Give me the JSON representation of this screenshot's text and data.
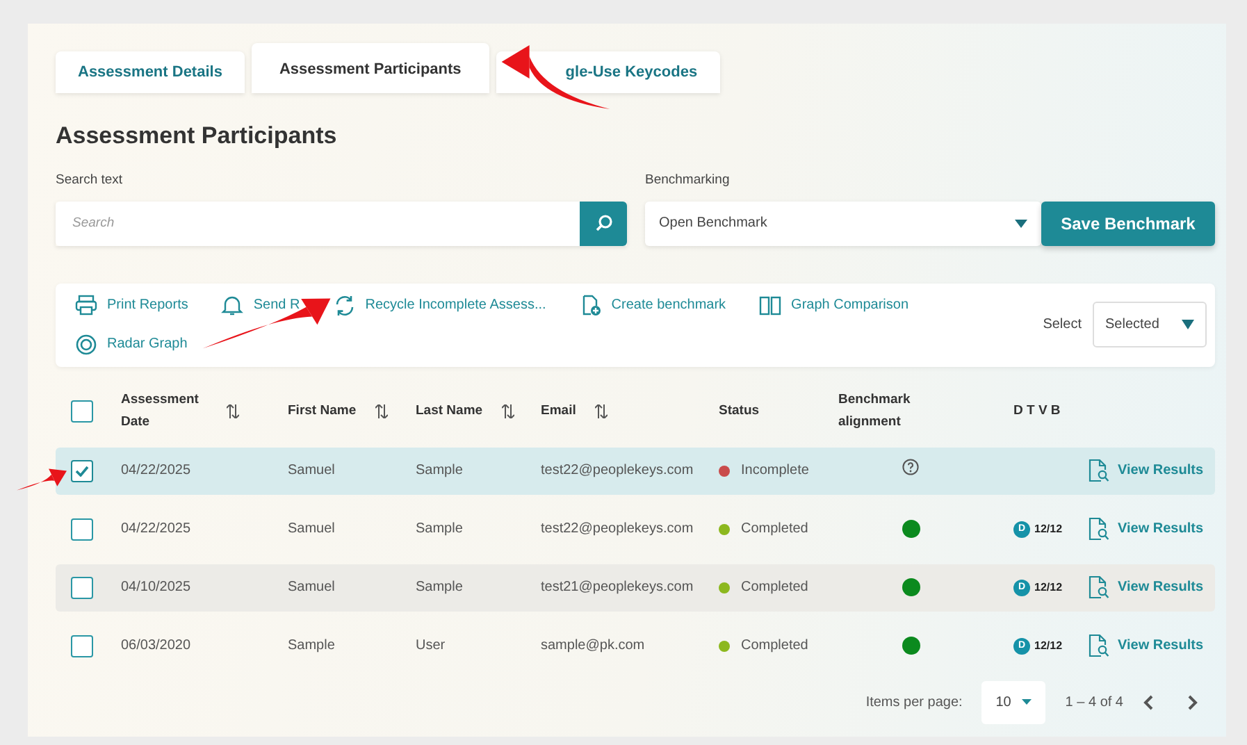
{
  "tabs": [
    {
      "label": "Assessment Details",
      "selected": false
    },
    {
      "label": "Assessment Participants",
      "selected": true
    },
    {
      "label": "gle-Use Keycodes",
      "selected": false
    }
  ],
  "title": "Assessment Participants",
  "search": {
    "label": "Search text",
    "placeholder": "Search"
  },
  "benchmarking": {
    "label": "Benchmarking",
    "value": "Open Benchmark"
  },
  "save_button": "Save Benchmark",
  "toolbar": {
    "actions": [
      "Print Reports",
      "Send R",
      "Recycle Incomplete Assess...",
      "Create benchmark",
      "Graph Comparison",
      "Radar Graph"
    ],
    "select": {
      "label": "Select",
      "value": "Selected"
    }
  },
  "table": {
    "select_all": false,
    "columns": [
      {
        "label": "Assessment Date",
        "sortable": true
      },
      {
        "label": "First Name",
        "sortable": true
      },
      {
        "label": "Last Name",
        "sortable": true
      },
      {
        "label": "Email",
        "sortable": true
      },
      {
        "label": "Status",
        "sortable": false
      },
      {
        "label": "Benchmark alignment",
        "sortable": false
      },
      {
        "label": "D T V B",
        "sortable": false
      }
    ],
    "rows": [
      {
        "checked": true,
        "date": "04/22/2025",
        "first": "Samuel",
        "last": "Sample",
        "email": "test22@peoplekeys.com",
        "status": "Incomplete",
        "color": "#c94b4b",
        "aligned": false,
        "badge": null,
        "action": "View Results"
      },
      {
        "checked": false,
        "date": "04/22/2025",
        "first": "Samuel",
        "last": "Sample",
        "email": "test22@peoplekeys.com",
        "status": "Completed",
        "color": "#8cb81e",
        "aligned": true,
        "badge": {
          "letter": "D",
          "score": "12/12"
        },
        "action": "View Results"
      },
      {
        "checked": false,
        "date": "04/10/2025",
        "first": "Samuel",
        "last": "Sample",
        "email": "test21@peoplekeys.com",
        "status": "Completed",
        "color": "#8cb81e",
        "aligned": true,
        "badge": {
          "letter": "D",
          "score": "12/12"
        },
        "action": "View Results"
      },
      {
        "checked": false,
        "date": "06/03/2020",
        "first": "Sample",
        "last": "User",
        "email": "sample@pk.com",
        "status": "Completed",
        "color": "#8cb81e",
        "aligned": true,
        "badge": {
          "letter": "D",
          "score": "12/12"
        },
        "action": "View Results"
      }
    ]
  },
  "pagination": {
    "label": "Items per page:",
    "value": "10",
    "range": "1 – 4 of 4"
  }
}
